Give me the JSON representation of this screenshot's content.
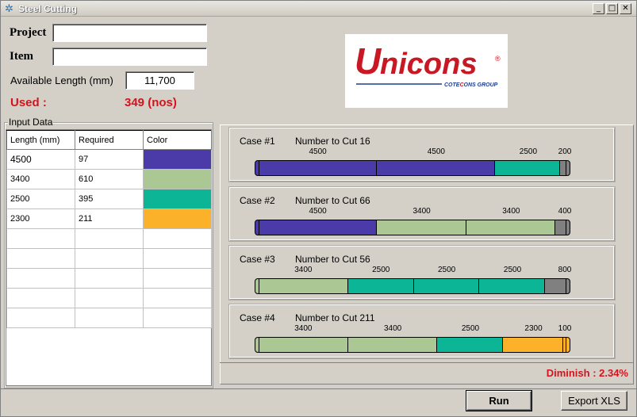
{
  "window": {
    "title": "Steel Cutting",
    "min_glyph": "_",
    "max_glyph": "□",
    "close_glyph": "✕"
  },
  "form": {
    "project_label": "Project",
    "project_value": "",
    "item_label": "Item",
    "item_value": "",
    "available_length_label": "Available Length (mm)",
    "available_length_value": "11,700",
    "used_label": "Used :",
    "used_value": "349 (nos)"
  },
  "logo": {
    "text": "Unicons",
    "registered": "®",
    "tagline_left": "COTE",
    "tagline_c": "C",
    "tagline_right": "ONS GROUP",
    "brand_color": "#c81824",
    "line_color": "#1a3f8f"
  },
  "input_data": {
    "title": "Input Data",
    "columns": [
      "Length (mm)",
      "Required",
      "Color"
    ],
    "rows": [
      {
        "length": "4500",
        "required": "97",
        "color": "#4a3ba8"
      },
      {
        "length": "3400",
        "required": "610",
        "color": "#abc894"
      },
      {
        "length": "2500",
        "required": "395",
        "color": "#0cb596"
      },
      {
        "length": "2300",
        "required": "211",
        "color": "#fcb12b"
      },
      {
        "length": "",
        "required": "",
        "color": ""
      },
      {
        "length": "",
        "required": "",
        "color": ""
      },
      {
        "length": "",
        "required": "",
        "color": ""
      },
      {
        "length": "",
        "required": "",
        "color": ""
      },
      {
        "length": "",
        "required": "",
        "color": ""
      }
    ]
  },
  "cases": [
    {
      "title": "Case #1",
      "cut_label": "Number to Cut 16",
      "segments": [
        {
          "label": "4500",
          "length": 4500,
          "color": "#4a3ba8"
        },
        {
          "label": "4500",
          "length": 4500,
          "color": "#4a3ba8"
        },
        {
          "label": "2500",
          "length": 2500,
          "color": "#0cb596"
        },
        {
          "label": "200",
          "length": 200,
          "color": "#808080"
        }
      ]
    },
    {
      "title": "Case #2",
      "cut_label": "Number to Cut 66",
      "segments": [
        {
          "label": "4500",
          "length": 4500,
          "color": "#4a3ba8"
        },
        {
          "label": "3400",
          "length": 3400,
          "color": "#abc894"
        },
        {
          "label": "3400",
          "length": 3400,
          "color": "#abc894"
        },
        {
          "label": "400",
          "length": 400,
          "color": "#808080"
        }
      ]
    },
    {
      "title": "Case #3",
      "cut_label": "Number to Cut 56",
      "segments": [
        {
          "label": "3400",
          "length": 3400,
          "color": "#abc894"
        },
        {
          "label": "2500",
          "length": 2500,
          "color": "#0cb596"
        },
        {
          "label": "2500",
          "length": 2500,
          "color": "#0cb596"
        },
        {
          "label": "2500",
          "length": 2500,
          "color": "#0cb596"
        },
        {
          "label": "800",
          "length": 800,
          "color": "#808080"
        }
      ]
    },
    {
      "title": "Case #4",
      "cut_label": "Number to Cut 211",
      "segments": [
        {
          "label": "3400",
          "length": 3400,
          "color": "#abc894"
        },
        {
          "label": "3400",
          "length": 3400,
          "color": "#abc894"
        },
        {
          "label": "2500",
          "length": 2500,
          "color": "#0cb596"
        },
        {
          "label": "2300",
          "length": 2300,
          "color": "#fcb12b"
        },
        {
          "label": "100",
          "length": 100,
          "color": "#fcb12b"
        }
      ]
    }
  ],
  "diminish": "Diminish : 2.34%",
  "buttons": {
    "run": "Run",
    "export": "Export XLS"
  }
}
